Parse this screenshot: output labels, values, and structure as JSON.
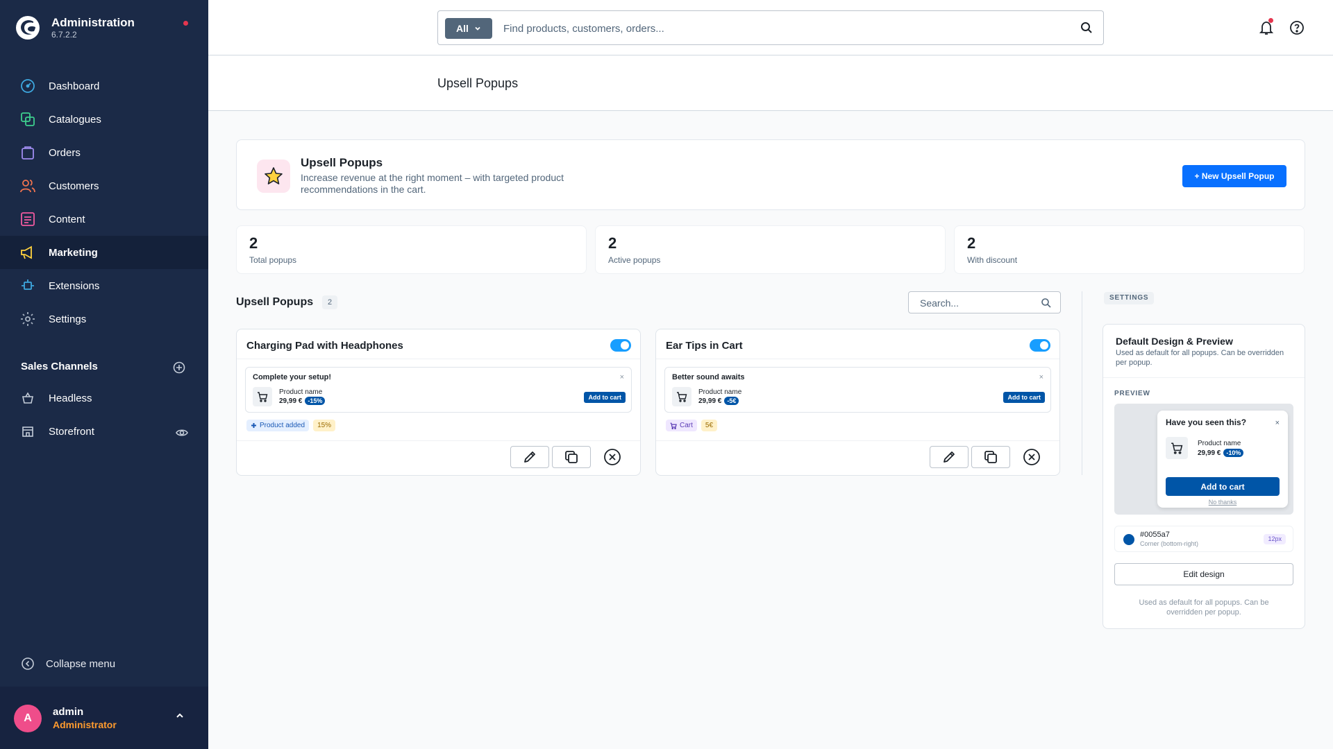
{
  "app": {
    "title": "Administration",
    "version": "6.7.2.2"
  },
  "sidebar": {
    "items": [
      {
        "label": "Dashboard",
        "icon": "dashboard-icon"
      },
      {
        "label": "Catalogues",
        "icon": "catalogues-icon"
      },
      {
        "label": "Orders",
        "icon": "orders-icon"
      },
      {
        "label": "Customers",
        "icon": "customers-icon"
      },
      {
        "label": "Content",
        "icon": "content-icon"
      },
      {
        "label": "Marketing",
        "icon": "marketing-icon",
        "active": true
      },
      {
        "label": "Extensions",
        "icon": "extensions-icon"
      },
      {
        "label": "Settings",
        "icon": "settings-icon"
      }
    ],
    "sales_channels_title": "Sales Channels",
    "sales_channels": [
      {
        "label": "Headless",
        "icon": "headless-icon"
      },
      {
        "label": "Storefront",
        "icon": "storefront-icon"
      }
    ],
    "collapse_label": "Collapse menu",
    "user": {
      "initial": "A",
      "name": "admin",
      "role": "Administrator"
    }
  },
  "search": {
    "type": "All",
    "placeholder": "Find products, customers, orders..."
  },
  "page": {
    "title": "Upsell Popups"
  },
  "intro": {
    "title": "Upsell Popups",
    "description": "Increase revenue at the right moment – with targeted product recommendations in the cart.",
    "new_button": "+ New Upsell Popup"
  },
  "stats": [
    {
      "value": "2",
      "label": "Total popups"
    },
    {
      "value": "2",
      "label": "Active popups"
    },
    {
      "value": "2",
      "label": "With discount"
    }
  ],
  "list": {
    "title": "Upsell Popups",
    "count": "2",
    "search_placeholder": "Search..."
  },
  "popups": [
    {
      "title": "Charging Pad with Headphones",
      "enabled": true,
      "preview": {
        "headline": "Complete your setup!",
        "product": "Product name",
        "price": "29,99 €",
        "badge": "-15%",
        "button": "Add to cart",
        "close": "×"
      },
      "trigger": "Product added",
      "discount": "15%"
    },
    {
      "title": "Ear Tips in Cart",
      "enabled": true,
      "preview": {
        "headline": "Better sound awaits",
        "product": "Product name",
        "price": "29,99 €",
        "badge": "-5€",
        "button": "Add to cart",
        "close": "×"
      },
      "trigger": "Cart",
      "discount": "5€"
    }
  ],
  "settings": {
    "label": "SETTINGS",
    "title": "Default Design & Preview",
    "description": "Used as default for all popups. Can be overridden per popup.",
    "preview_label": "PREVIEW",
    "preview": {
      "headline": "Have you seen this?",
      "product": "Product name",
      "price": "29,99 €",
      "badge": "-10%",
      "button": "Add to cart",
      "dismiss": "No thanks",
      "close": "×"
    },
    "color": "#0055a7",
    "position": "Corner (bottom-right)",
    "radius": "12px",
    "edit_button": "Edit design",
    "footer": "Used as default for all popups. Can be overridden per popup."
  },
  "colors": {
    "sidebar": "#1b2a47",
    "accent": "#0870ff",
    "popup": "#0055a7",
    "toggle": "#189eff"
  }
}
